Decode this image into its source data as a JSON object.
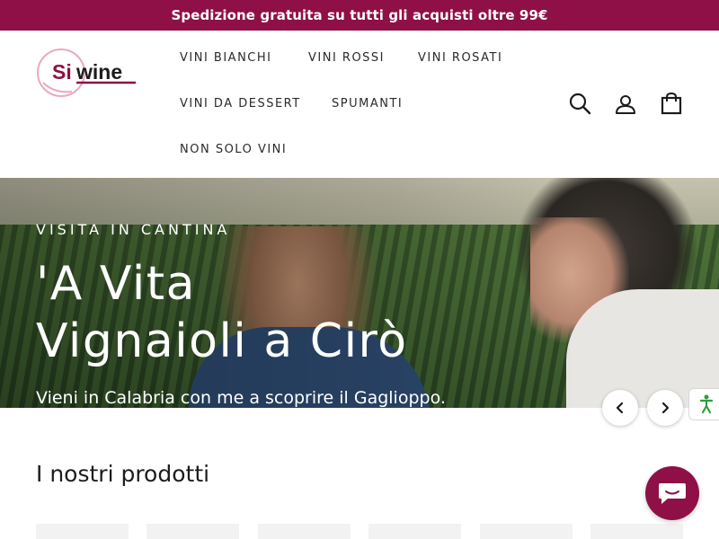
{
  "announcement": {
    "text": "Spedizione gratuita su tutti gli acquisti oltre 99€"
  },
  "logo": {
    "text_si": "Si",
    "text_wine": "wine",
    "brand_color": "#8f1047"
  },
  "nav": {
    "items": [
      {
        "label": "VINI BIANCHI"
      },
      {
        "label": "VINI ROSSI"
      },
      {
        "label": "VINI ROSATI"
      },
      {
        "label": "VINI DA DESSERT"
      },
      {
        "label": "SPUMANTI"
      },
      {
        "label": "NON SOLO VINI"
      }
    ]
  },
  "header_icons": [
    "search-icon",
    "account-icon",
    "cart-icon"
  ],
  "hero": {
    "eyebrow": "VISITA IN CANTINA",
    "title_line1": "'A Vita",
    "title_line2": "Vignaioli a Cirò",
    "subtitle": "Vieni in Calabria con me a scoprire il Gaglioppo."
  },
  "slider": {
    "prev_icon": "chevron-left-icon",
    "next_icon": "chevron-right-icon"
  },
  "side_badge": {
    "icon": "accessibility-icon",
    "color": "#2e9e3e"
  },
  "products": {
    "title": "I nostri prodotti"
  },
  "chat": {
    "icon": "chat-icon"
  },
  "colors": {
    "accent": "#8f1047",
    "text": "#1c1c1c"
  }
}
